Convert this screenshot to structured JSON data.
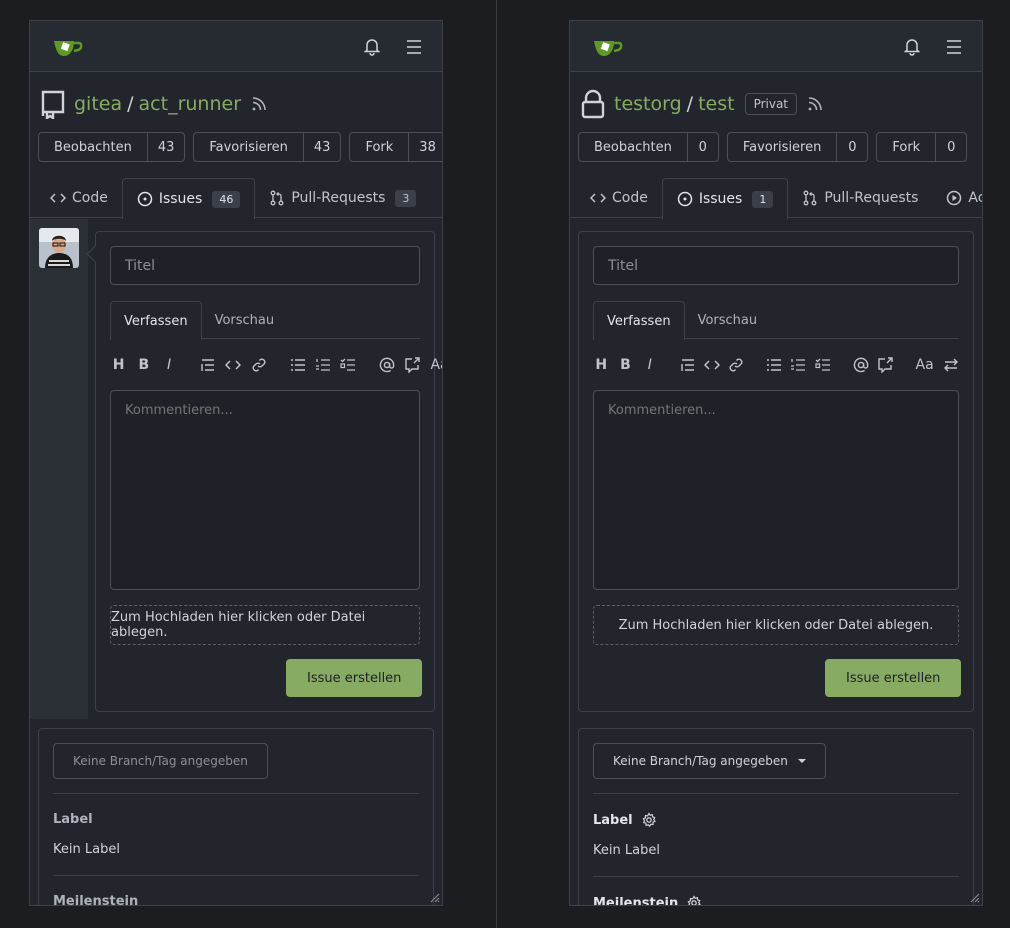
{
  "left": {
    "owner": "gitea",
    "repo": "act_runner",
    "private_badge": "",
    "stats": [
      {
        "label": "Beobachten",
        "count": "43"
      },
      {
        "label": "Favorisieren",
        "count": "43"
      },
      {
        "label": "Fork",
        "count": "38"
      }
    ],
    "tabs": [
      {
        "label": "Code",
        "count": ""
      },
      {
        "label": "Issues",
        "count": "46"
      },
      {
        "label": "Pull-Requests",
        "count": "3"
      },
      {
        "label": "",
        "count": ""
      }
    ],
    "title_placeholder": "Titel",
    "editor_tabs": [
      "Verfassen",
      "Vorschau"
    ],
    "comment_placeholder": "Kommentieren...",
    "dropzone": "Zum Hochladen hier klicken oder Datei ablegen.",
    "submit": "Issue erstellen",
    "branch": "Keine Branch/Tag angegeben",
    "label_title": "Label",
    "label_value": "Kein Label",
    "milestone_title": "Meilenstein"
  },
  "right": {
    "owner": "testorg",
    "repo": "test",
    "private_badge": "Privat",
    "stats": [
      {
        "label": "Beobachten",
        "count": "0"
      },
      {
        "label": "Favorisieren",
        "count": "0"
      },
      {
        "label": "Fork",
        "count": "0"
      }
    ],
    "tabs": [
      {
        "label": "Code",
        "count": ""
      },
      {
        "label": "Issues",
        "count": "1"
      },
      {
        "label": "Pull-Requests",
        "count": ""
      },
      {
        "label": "Actio",
        "count": ""
      }
    ],
    "title_placeholder": "Titel",
    "editor_tabs": [
      "Verfassen",
      "Vorschau"
    ],
    "comment_placeholder": "Kommentieren...",
    "dropzone": "Zum Hochladen hier klicken oder Datei ablegen.",
    "submit": "Issue erstellen",
    "branch": "Keine Branch/Tag angegeben",
    "label_title": "Label",
    "label_value": "Kein Label",
    "milestone_title": "Meilenstein"
  },
  "toolbar_icons": [
    "heading-icon",
    "bold-icon",
    "italic-icon",
    "quote-icon",
    "code-icon",
    "link-icon",
    "unordered-list-icon",
    "ordered-list-icon",
    "task-list-icon",
    "mention-icon",
    "cross-reference-icon",
    "font-size-icon",
    "switch-editor-icon"
  ],
  "colors": {
    "accent": "#87ab63",
    "bg": "#22252c",
    "border": "#3d4149"
  }
}
